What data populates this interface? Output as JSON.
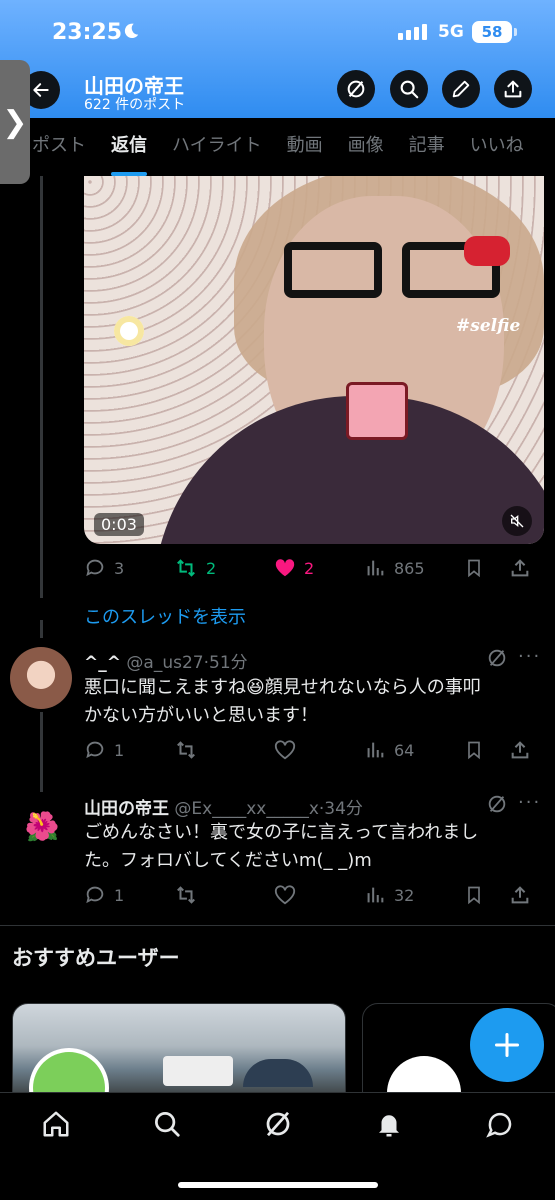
{
  "status_bar": {
    "time": "23:25",
    "network": "5G",
    "battery": "58"
  },
  "header": {
    "title": "山田の帝王",
    "subtitle": "622 件のポスト"
  },
  "tabs": [
    {
      "label": "ポスト"
    },
    {
      "label": "返信",
      "active": true
    },
    {
      "label": "ハイライト"
    },
    {
      "label": "動画"
    },
    {
      "label": "画像"
    },
    {
      "label": "記事"
    },
    {
      "label": "いいね"
    }
  ],
  "video": {
    "duration": "0:03",
    "overlay_text": "#selfie"
  },
  "post_stats": {
    "replies": "3",
    "reposts": "2",
    "likes": "2",
    "views": "865"
  },
  "thread_link": "このスレッドを表示",
  "reply1": {
    "name": "^_^",
    "handle": "@a_us27",
    "time": "51分",
    "text_line1": "悪口に聞こえますね😆顔見せれないなら人の事叩",
    "text_line2": "かない方がいいと思います！",
    "replies": "1",
    "views": "64"
  },
  "reply2": {
    "name": "山田の帝王",
    "handle": "@Ex____xx_____x",
    "time": "34分",
    "text_line1": "ごめんなさい！裏で女の子に言えって言われまし",
    "text_line2": "た。フォロバしてくださいm(_ _)m",
    "replies": "1",
    "views": "32"
  },
  "recommend": {
    "title": "おすすめユーザー"
  },
  "colors": {
    "accent": "#1d9bf0",
    "like": "#f91880",
    "repost": "#00ba7c",
    "header_top": "#6fb2ff"
  }
}
